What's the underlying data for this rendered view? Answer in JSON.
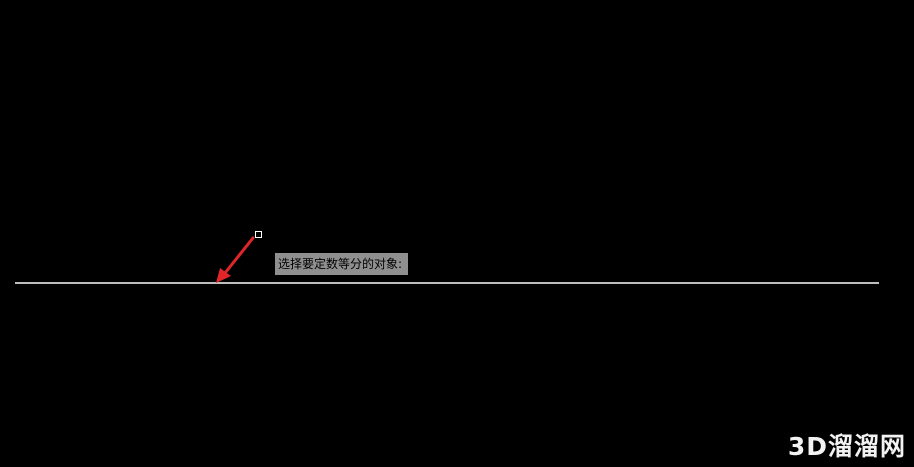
{
  "drawing_area": {
    "prompt_text": "选择要定数等分的对象:",
    "background_color": "#000000",
    "line_color": "#bdbdbd",
    "annotation_arrow_color": "#e0252b",
    "tooltip_background": "#8f8f8f"
  },
  "watermark": {
    "text": "3D溜溜网"
  }
}
